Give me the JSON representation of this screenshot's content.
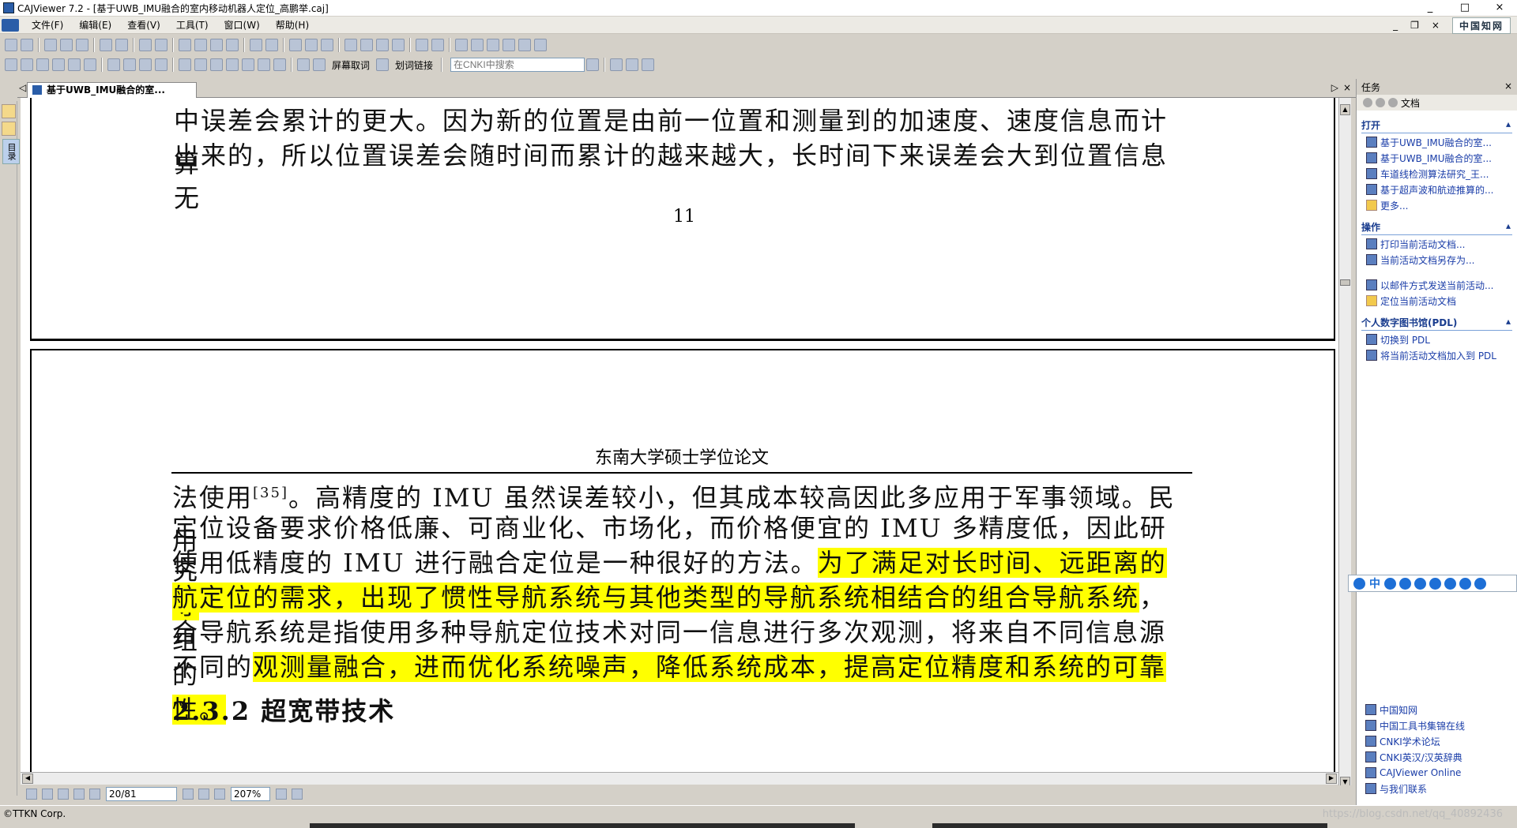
{
  "window": {
    "title": "CAJViewer 7.2 - [基于UWB_IMU融合的室内移动机器人定位_高鹏举.caj]",
    "min": "_",
    "max": "□",
    "close": "×"
  },
  "menu": {
    "items": [
      "文件(F)",
      "编辑(E)",
      "查看(V)",
      "工具(T)",
      "窗口(W)",
      "帮助(H)"
    ],
    "right_min": "_",
    "right_restore": "❐",
    "right_close": "×",
    "cnki": "中国知网"
  },
  "toolbar": {
    "screen_select": "屏幕取词",
    "word_link": "划词链接",
    "search_placeholder": "在CNKI中搜索"
  },
  "left_panel": {
    "toc_label": "目录"
  },
  "doc_tab": {
    "label": "基于UWB_IMU融合的室...",
    "left_arrow": "◁",
    "right_arrow": "▷",
    "close": "×"
  },
  "page1": {
    "line1": "中误差会累计的更大。因为新的位置是由前一位置和测量到的加速度、速度信息而计算",
    "line2": "出来的，所以位置误差会随时间而累计的越来越大，长时间下来误差会大到位置信息无",
    "page_number": "11"
  },
  "page2": {
    "header": "东南大学硕士学位论文",
    "l1_a": "法使用",
    "l1_sup": "[35]",
    "l1_b": "。高精度的 IMU 虽然误差较小，但其成本较高因此多应用于军事领域。民用",
    "l2": "定位设备要求价格低廉、可商业化、市场化，而价格便宜的 IMU 多精度低，因此研究",
    "l3_a": "使用低精度的 IMU 进行融合定位是一种很好的方法。",
    "l3_hl": "为了满足对长时间、远距离的导",
    "l4_hl": "航定位的需求，出现了惯性导航系统与其他类型的导航系统相结合的组合导航系统",
    "l4_b": "，组",
    "l5": "合导航系统是指使用多种导航定位技术对同一信息进行多次观测，将来自不同信息源的",
    "l6_a": "不同的",
    "l6_hl": "观测量融合，进而优化系统噪声，降低系统成本，提高定位精度和系统的可靠性。",
    "l7": "2.3.2 超宽带技术"
  },
  "navbar": {
    "page_value": "20/81",
    "zoom_value": "207%"
  },
  "status": {
    "company": "©TTKN Corp.",
    "watermark": "https://blog.csdn.net/qq_40892436"
  },
  "taskpane": {
    "title": "任务",
    "close": "×",
    "sub_label": "文档",
    "open_title": "打开",
    "open_items": [
      "基于UWB_IMU融合的室...",
      "基于UWB_IMU融合的室...",
      "车道线检测算法研究_王...",
      "基于超声波和航迹推算的...",
      "更多..."
    ],
    "ops_title": "操作",
    "ops_items": [
      "打印当前活动文档...",
      "当前活动文档另存为...",
      "以邮件方式发送当前活动...",
      "定位当前活动文档"
    ],
    "pdl_title": "个人数字图书馆(PDL)",
    "pdl_items": [
      "切换到 PDL",
      "将当前活动文档加入到 PDL"
    ],
    "link_items": [
      "中国知网",
      "中国工具书集锦在线",
      "CNKI学术论坛",
      "CNKI英汉/汉英辞典",
      "CAJViewer Online",
      "与我们联系"
    ],
    "collapse": "▴"
  },
  "ime": {
    "lang": "中"
  }
}
